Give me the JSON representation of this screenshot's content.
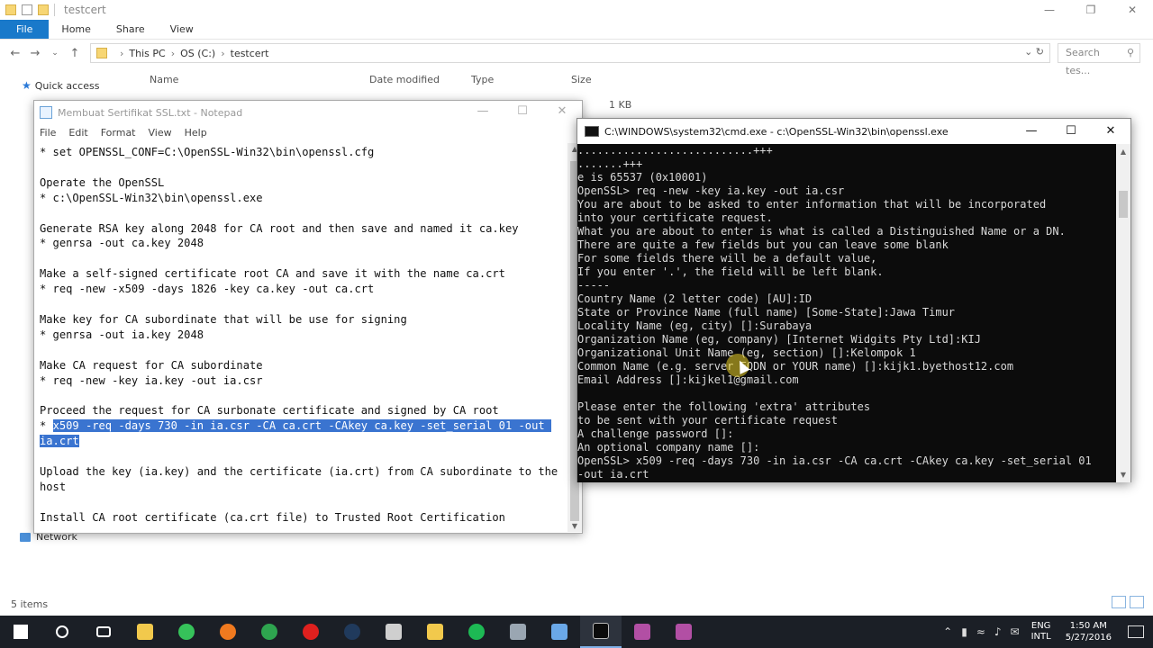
{
  "explorer": {
    "title": "testcert",
    "ribbon_tabs": [
      "File",
      "Home",
      "Share",
      "View"
    ],
    "breadcrumb": [
      "This PC",
      "OS (C:)",
      "testcert"
    ],
    "search_placeholder": "Search tes...",
    "columns": {
      "name": "Name",
      "date": "Date modified",
      "type": "Type",
      "size": "Size"
    },
    "size_value": "1 KB",
    "nav": {
      "quick_access": "Quick access",
      "network": "Network"
    },
    "status": "5 items"
  },
  "notepad": {
    "title": "Membuat Sertifikat SSL.txt - Notepad",
    "menu": [
      "File",
      "Edit",
      "Format",
      "View",
      "Help"
    ],
    "text_before": "* set OPENSSL_CONF=C:\\OpenSSL-Win32\\bin\\openssl.cfg\n\nOperate the OpenSSL\n* c:\\OpenSSL-Win32\\bin\\openssl.exe\n\nGenerate RSA key along 2048 for CA root and then save and named it ca.key\n* genrsa -out ca.key 2048\n\nMake a self-signed certificate root CA and save it with the name ca.crt\n* req -new -x509 -days 1826 -key ca.key -out ca.crt\n\nMake key for CA subordinate that will be use for signing\n* genrsa -out ia.key 2048\n\nMake CA request for CA subordinate\n* req -new -key ia.key -out ia.csr\n\nProceed the request for CA surbonate certificate and signed by CA root\n* ",
    "text_selected": "x509 -req -days 730 -in ia.csr -CA ca.crt -CAkey ca.key -set_serial 01 -out ia.crt",
    "text_after": "\n\nUpload the key (ia.key) and the certificate (ia.crt) from CA subordinate to the host\n\nInstall CA root certificate (ca.crt file) to Trusted Root Certification"
  },
  "cmd": {
    "title": "C:\\WINDOWS\\system32\\cmd.exe - c:\\OpenSSL-Win32\\bin\\openssl.exe",
    "output": "...........................+++\n.......+++\ne is 65537 (0x10001)\nOpenSSL> req -new -key ia.key -out ia.csr\nYou are about to be asked to enter information that will be incorporated\ninto your certificate request.\nWhat you are about to enter is what is called a Distinguished Name or a DN.\nThere are quite a few fields but you can leave some blank\nFor some fields there will be a default value,\nIf you enter '.', the field will be left blank.\n-----\nCountry Name (2 letter code) [AU]:ID\nState or Province Name (full name) [Some-State]:Jawa Timur\nLocality Name (eg, city) []:Surabaya\nOrganization Name (eg, company) [Internet Widgits Pty Ltd]:KIJ\nOrganizational Unit Name (eg, section) []:Kelompok 1\nCommon Name (e.g. server FQDN or YOUR name) []:kijk1.byethost12.com\nEmail Address []:kijkel1@gmail.com\n\nPlease enter the following 'extra' attributes\nto be sent with your certificate request\nA challenge password []:\nAn optional company name []:\nOpenSSL> x509 -req -days 730 -in ia.csr -CA ca.crt -CAkey ca.key -set_serial 01\n-out ia.crt"
  },
  "taskbar": {
    "icons": [
      "windows-start-icon",
      "search-icon",
      "task-view-icon",
      "file-explorer-icon",
      "line-icon",
      "firefox-icon",
      "chrome-icon",
      "opera-icon",
      "steam-icon",
      "calendar-app-icon",
      "folder-icon",
      "spotify-icon",
      "app-icon",
      "notepad-icon",
      "cmd-icon",
      "app-icon-2",
      "app-icon-3"
    ],
    "icon_colors": [
      "#ffffff",
      "#ffffff",
      "#ffffff",
      "#f2c94c",
      "#36c25a",
      "#f07a1f",
      "#2ea44f",
      "#e0201e",
      "#203a5c",
      "#cfcfcf",
      "#f2c94c",
      "#1db954",
      "#9aa6b2",
      "#6aa8e8",
      "#0c0c0c",
      "#b24fa4",
      "#b24fa4"
    ],
    "language": {
      "line1": "ENG",
      "line2": "INTL"
    },
    "time": "1:50 AM",
    "date": "5/27/2016"
  }
}
